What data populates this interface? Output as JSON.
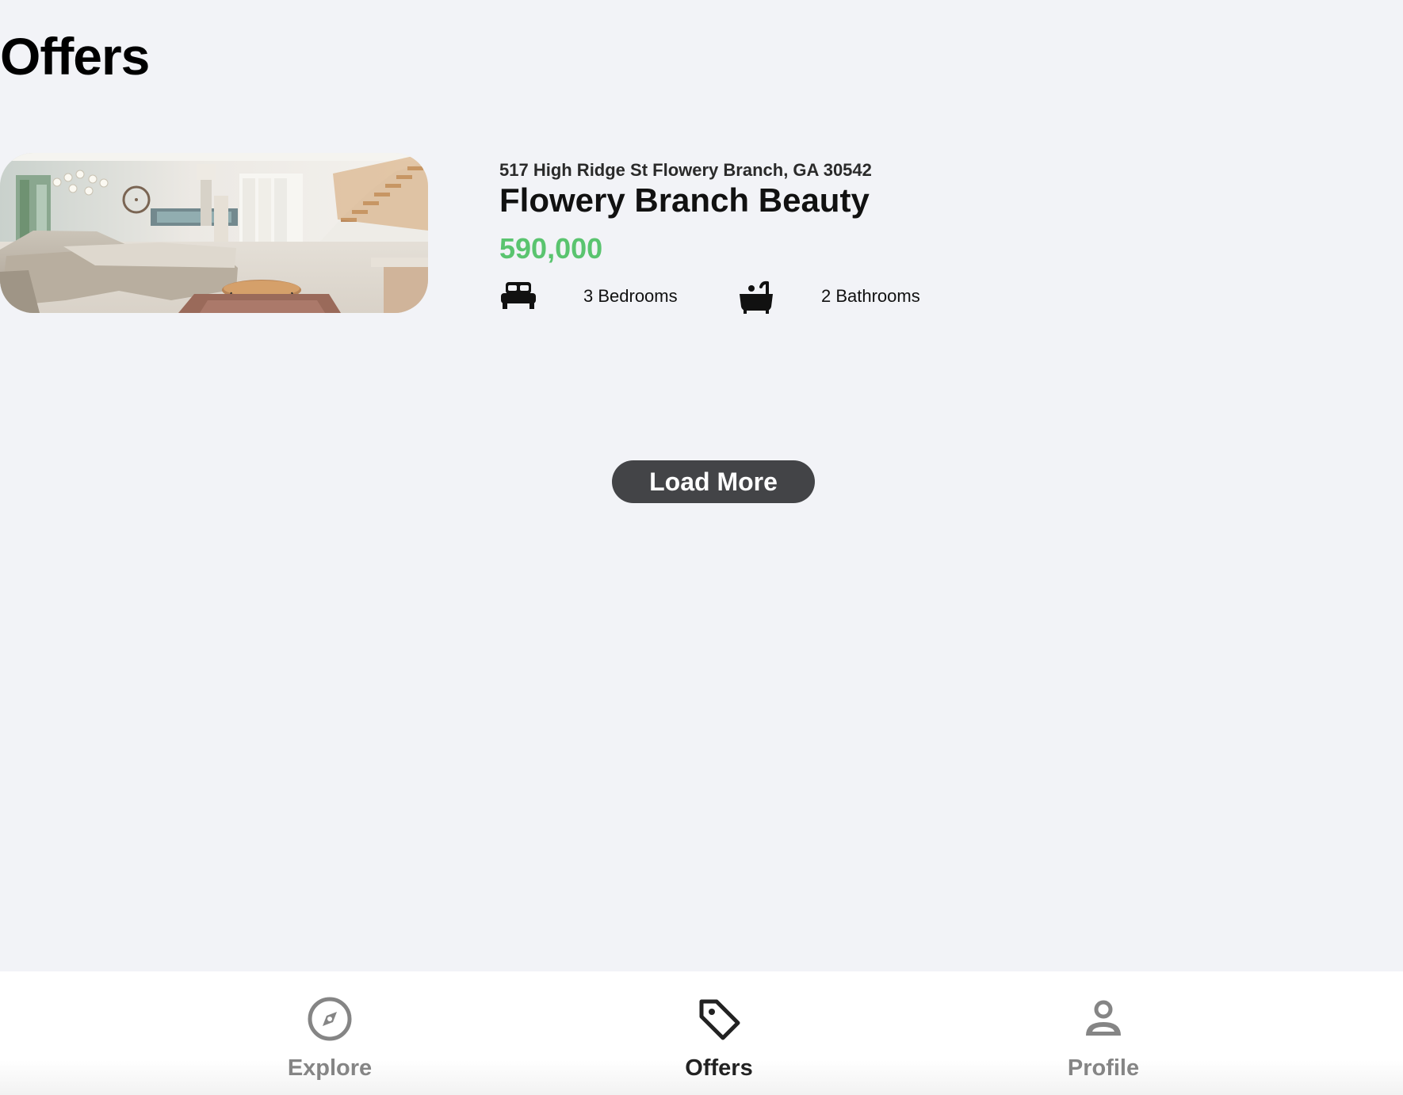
{
  "header": {
    "title": "Offers"
  },
  "listing": {
    "address": "517 High Ridge St Flowery Branch, GA 30542",
    "title": "Flowery Branch Beauty",
    "price": "590,000",
    "bedrooms": "3 Bedrooms",
    "bathrooms": "2 Bathrooms",
    "bed_icon": "bed-icon",
    "bath_icon": "bathtub-icon"
  },
  "actions": {
    "load_more_label": "Load More"
  },
  "bottom_nav": {
    "items": [
      {
        "label": "Explore",
        "icon": "compass-icon",
        "active": false
      },
      {
        "label": "Offers",
        "icon": "tag-icon",
        "active": true
      },
      {
        "label": "Profile",
        "icon": "user-icon",
        "active": false
      }
    ]
  },
  "colors": {
    "background": "#f2f3f7",
    "price": "#5ac46f",
    "button": "#434447",
    "nav_active": "#222222",
    "nav_inactive": "#858585"
  }
}
